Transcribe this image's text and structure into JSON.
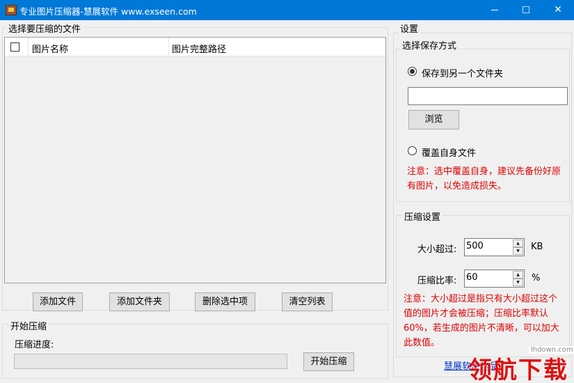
{
  "window": {
    "title": "专业图片压缩器-慧展软件 www.exseen.com",
    "controls": {
      "minimize": "",
      "maximize": "",
      "close": "✕"
    }
  },
  "file_group": {
    "title": "选择要压缩的文件",
    "columns": [
      "图片名称",
      "图片完整路径"
    ],
    "rows": []
  },
  "buttons": {
    "add_file": "添加文件",
    "add_folder": "添加文件夹",
    "delete_selected": "删除选中项",
    "clear_list": "清空列表"
  },
  "start_group": {
    "title": "开始压缩",
    "progress_label": "压缩进度:",
    "progress": 0,
    "start_button": "开始压缩"
  },
  "settings": {
    "title": "设置",
    "save_mode": {
      "title": "选择保存方式",
      "option_other_folder": "保存到另一个文件夹",
      "option_other_folder_selected": true,
      "folder_path": "",
      "browse_button": "浏览",
      "option_overwrite": "覆盖自身文件",
      "option_overwrite_selected": false,
      "note": "注意：选中覆盖自身，建议先备份好原有图片，以免造成损失。"
    },
    "compress": {
      "title": "压缩设置",
      "size_label": "大小超过:",
      "size_value": "500",
      "size_unit": "KB",
      "ratio_label": "压缩比率:",
      "ratio_value": "60",
      "ratio_unit": "%",
      "note": "注意：大小超过是指只有大小超过这个值的图片才会被压缩；压缩比率默认60%，若生成的图片不清晰，可以加大此数值。"
    }
  },
  "footer": {
    "link": "慧展软件作品",
    "watermark_small": "lhdown.com",
    "watermark_big": "领航下载"
  },
  "colors": {
    "titlebar": "#0078d7",
    "note_red": "#e00000",
    "link_blue": "#0033cc"
  }
}
